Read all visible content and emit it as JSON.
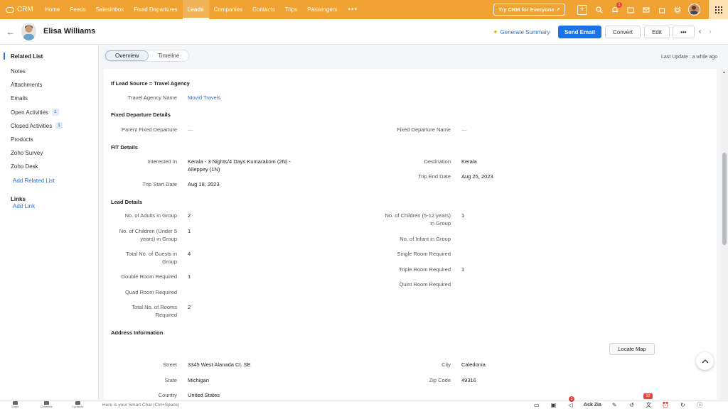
{
  "app": {
    "name": "CRM"
  },
  "nav": {
    "items": [
      {
        "label": "Home"
      },
      {
        "label": "Feeds"
      },
      {
        "label": "SalesInbox"
      },
      {
        "label": "Fixed Departures"
      },
      {
        "label": "Leads",
        "active": true
      },
      {
        "label": "Companies"
      },
      {
        "label": "Contacts"
      },
      {
        "label": "Trips"
      },
      {
        "label": "Passengers"
      }
    ],
    "more": "•••",
    "try_button": "Try CRM for Everyone ↗",
    "notification_count": "1"
  },
  "record": {
    "name": "Elisa Williams",
    "generate_summary": "Generate Summary",
    "send_email": "Send Email",
    "convert": "Convert",
    "edit": "Edit",
    "more": "•••"
  },
  "sidebar": {
    "title": "Related List",
    "items": [
      {
        "label": "Notes"
      },
      {
        "label": "Attachments"
      },
      {
        "label": "Emails"
      },
      {
        "label": "Open Activities",
        "count": "1"
      },
      {
        "label": "Closed Activities",
        "count": "1"
      },
      {
        "label": "Products"
      },
      {
        "label": "Zoho Survey"
      },
      {
        "label": "Zoho Desk"
      }
    ],
    "add_related": "Add Related List",
    "links_title": "Links",
    "add_link": "Add Link"
  },
  "tabs": {
    "overview": "Overview",
    "timeline": "Timeline",
    "last_update": "Last Update : a while ago"
  },
  "sections": {
    "travel_agency": {
      "title": "If Lead Source = Travel Agency",
      "agency_name_label": "Travel Agency Name",
      "agency_name_value": "Movid Travels"
    },
    "fixed_departure": {
      "title": "Fixed Departure Details",
      "parent_label": "Parent Fixed Departure",
      "parent_value": "—",
      "name_label": "Fixed Departure Name",
      "name_value": "—"
    },
    "fit": {
      "title": "FIT Details",
      "interested_label": "Interested In",
      "interested_value_1": "Kerala - 3 Nights/4 Days Kumarakom (2N) -",
      "interested_value_2": "Alleppey (1N)",
      "destination_label": "Destination",
      "destination_value": "Kerala",
      "trip_end_label": "Trip End Date",
      "trip_end_value": "Aug 25, 2023",
      "trip_start_label": "Trip Start Date",
      "trip_start_value": "Aug 18, 2023"
    },
    "lead": {
      "title": "Lead Details",
      "adults_label": "No. of Adults in Group",
      "adults_value": "2",
      "children_5_12_label_1": "No. of Children (5-12 years)",
      "children_5_12_label_2": "in Group",
      "children_5_12_value": "1",
      "children_under5_label_1": "No. of Children (Under 5",
      "children_under5_label_2": "years) in Group",
      "children_under5_value": "1",
      "infant_label": "No. of Infant in Group",
      "guests_label_1": "Total No. of Guests in",
      "guests_label_2": "Group",
      "guests_value": "4",
      "single_label": "Single Room Required",
      "double_label": "Double Room Required",
      "double_value": "1",
      "triple_label": "Triple Room Required",
      "triple_value": "1",
      "quad_label": "Quad Room Required",
      "quint_label": "Quint Room Required",
      "rooms_label_1": "Total No. of Rooms",
      "rooms_label_2": "Required",
      "rooms_value": "2"
    },
    "address": {
      "title": "Address Information",
      "locate_map": "Locate Map",
      "street_label": "Street",
      "street_value": "3345 West Alanada Ct. SE",
      "city_label": "City",
      "city_value": "Caledonia",
      "state_label": "State",
      "state_value": "Michigan",
      "zip_label": "Zip Code",
      "zip_value": "49316",
      "country_label": "Country",
      "country_value": "United States"
    }
  },
  "bottom": {
    "tools": [
      {
        "label": "Chats"
      },
      {
        "label": "Channels"
      },
      {
        "label": "Contacts"
      }
    ],
    "smart_chat": "Here is your Smart Chat (Ctrl+Space)",
    "ask_zia": "Ask Zia",
    "megaphone_badge": "1",
    "alarm_badge": "10"
  }
}
